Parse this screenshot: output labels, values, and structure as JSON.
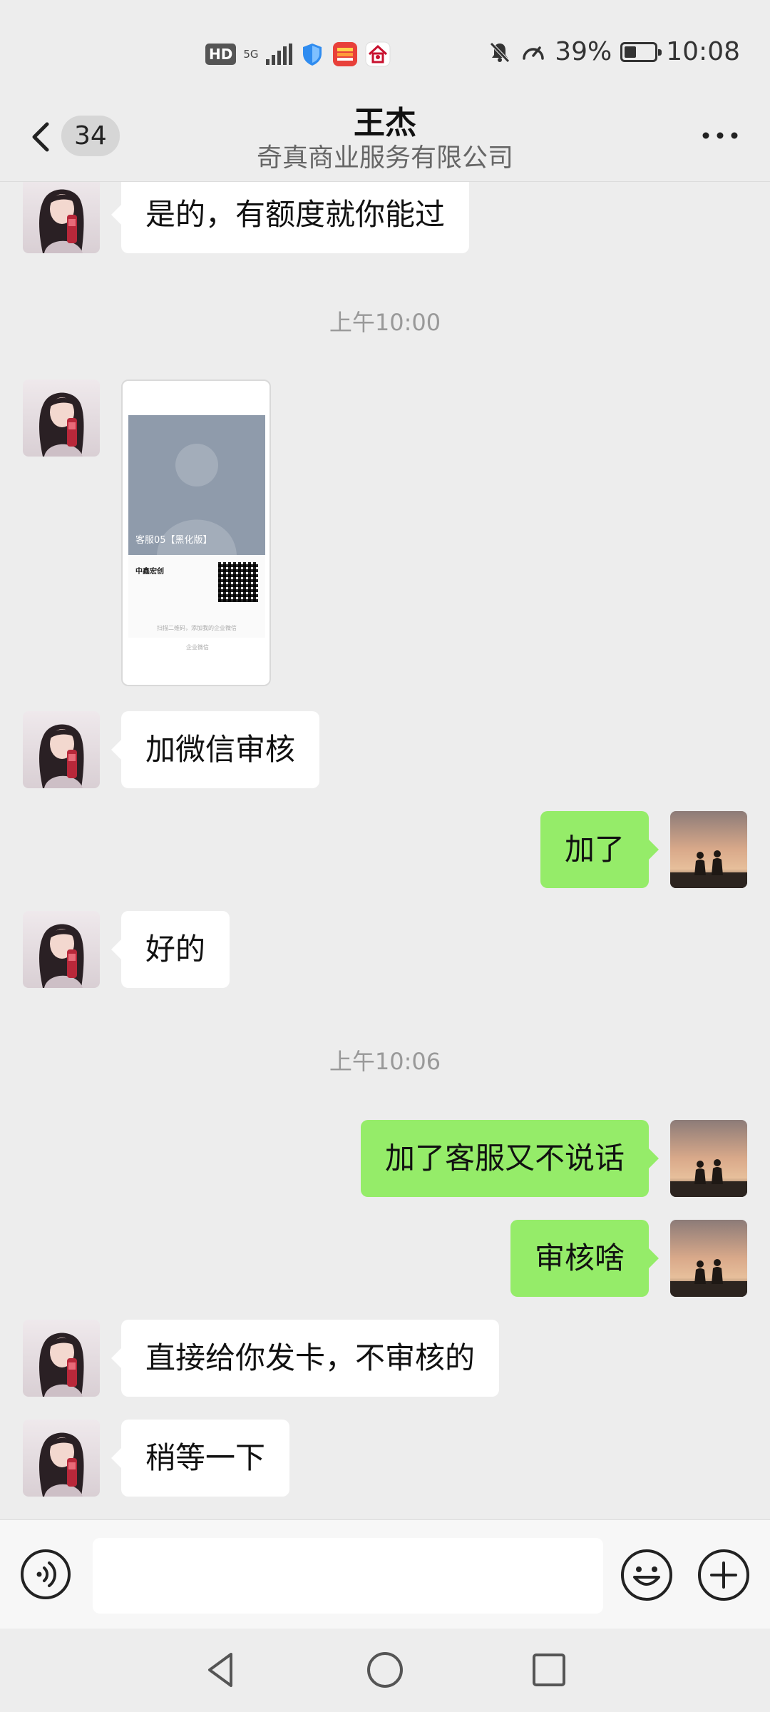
{
  "status_bar": {
    "hd": "HD",
    "network": "5G",
    "battery_percent": "39%",
    "battery_level": 0.39,
    "time": "10:08"
  },
  "header": {
    "unread_count": "34",
    "title": "王杰",
    "subtitle": "奇真商业服务有限公司"
  },
  "messages": [
    {
      "side": "left",
      "text": "是的，有额度就你能过"
    },
    {
      "timestamp": "上午10:00"
    },
    {
      "side": "left",
      "type": "card",
      "card": {
        "name": "客服05【黑化版】",
        "company": "中鑫宏创",
        "hint": "扫描二维码，添加我的企业微信",
        "footer": "企业微信"
      }
    },
    {
      "side": "left",
      "text": "加微信审核"
    },
    {
      "side": "right",
      "text": "加了"
    },
    {
      "side": "left",
      "text": "好的"
    },
    {
      "timestamp": "上午10:06"
    },
    {
      "side": "right",
      "text": "加了客服又不说话"
    },
    {
      "side": "right",
      "text": "审核啥"
    },
    {
      "side": "left",
      "text": "直接给你发卡，不审核的"
    },
    {
      "side": "left",
      "text": "稍等一下"
    }
  ],
  "input": {
    "placeholder": ""
  },
  "icons": {
    "back": "chevron-left-icon",
    "more": "more-dots-icon",
    "voice": "voice-icon",
    "emoji": "emoji-icon",
    "plus": "plus-icon"
  },
  "colors": {
    "background": "#ededed",
    "bubble_self": "#95ec69",
    "bubble_other": "#ffffff",
    "timestamp": "#999999"
  }
}
